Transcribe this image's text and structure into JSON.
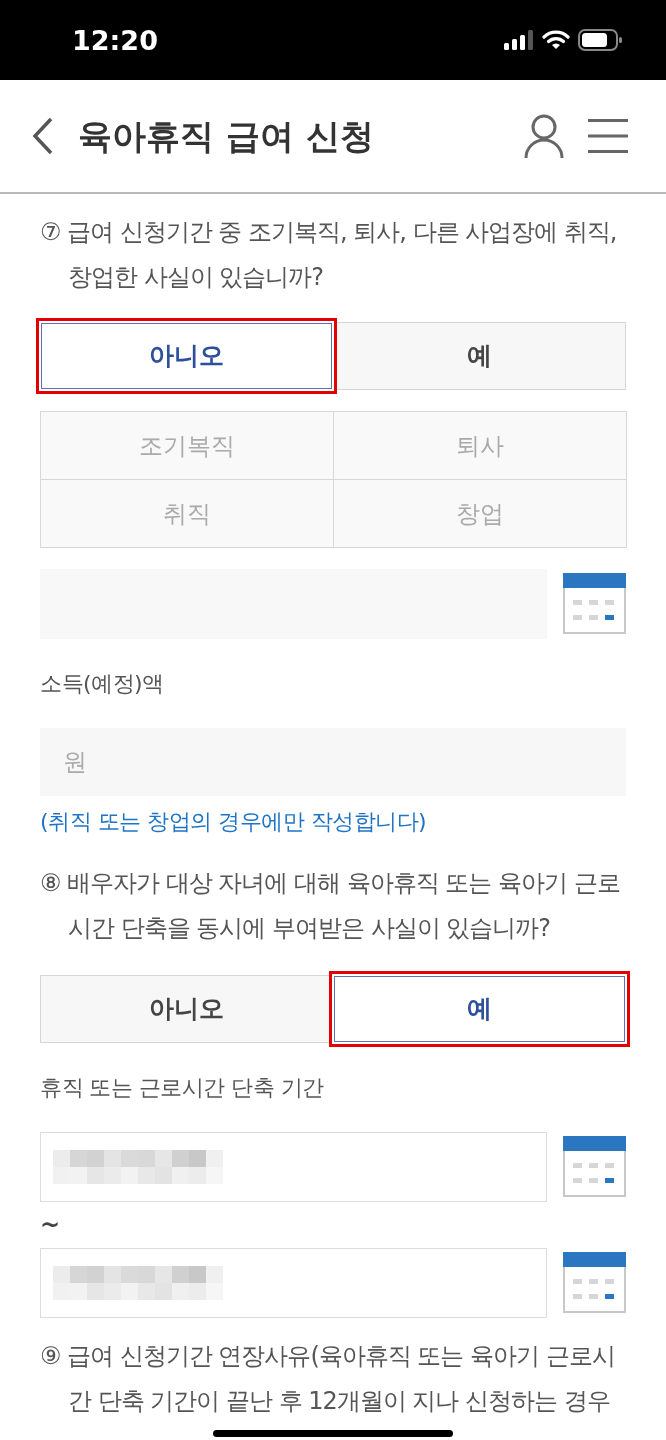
{
  "status_bar": {
    "time": "12:20"
  },
  "header": {
    "title": "육아휴직 급여 신청"
  },
  "sections": [
    {
      "kind": "question",
      "text": "⑦ 급여 신청기간 중 조기복직, 퇴사, 다른 사업장에 취직, 창업한 사실이 있습니까?"
    },
    {
      "kind": "choice",
      "options": [
        {
          "label": "아니오",
          "selected": true
        },
        {
          "label": "예",
          "selected": false
        }
      ]
    },
    {
      "kind": "option_grid",
      "options": [
        {
          "label": "조기복직",
          "disabled": true
        },
        {
          "label": "퇴사",
          "disabled": true
        },
        {
          "label": "취직",
          "disabled": true
        },
        {
          "label": "창업",
          "disabled": true
        }
      ]
    },
    {
      "kind": "date_field",
      "disabled": true,
      "blurred": false
    },
    {
      "kind": "label",
      "text": "소득(예정)액"
    },
    {
      "kind": "text_field",
      "placeholder": "원",
      "disabled": true
    },
    {
      "kind": "note",
      "text": "(취직 또는 창업의 경우에만 작성합니다)"
    },
    {
      "kind": "question",
      "text": "⑧ 배우자가 대상 자녀에 대해 육아휴직 또는 육아기 근로시간 단축을 동시에 부여받은 사실이 있습니까?"
    },
    {
      "kind": "choice",
      "options": [
        {
          "label": "아니오",
          "selected": false
        },
        {
          "label": "예",
          "selected": true
        }
      ]
    },
    {
      "kind": "label",
      "text": "휴직 또는 근로시간 단축 기간"
    },
    {
      "kind": "date_field",
      "disabled": false,
      "blurred": true
    },
    {
      "kind": "range_sign",
      "text": "~"
    },
    {
      "kind": "date_field",
      "disabled": false,
      "blurred": true
    },
    {
      "kind": "question",
      "text": "⑨ 급여 신청기간 연장사유(육아휴직 또는 육아기 근로시간 단축 기간이 끝난 후 12개월이 지나 신청하는 경우"
    }
  ]
}
